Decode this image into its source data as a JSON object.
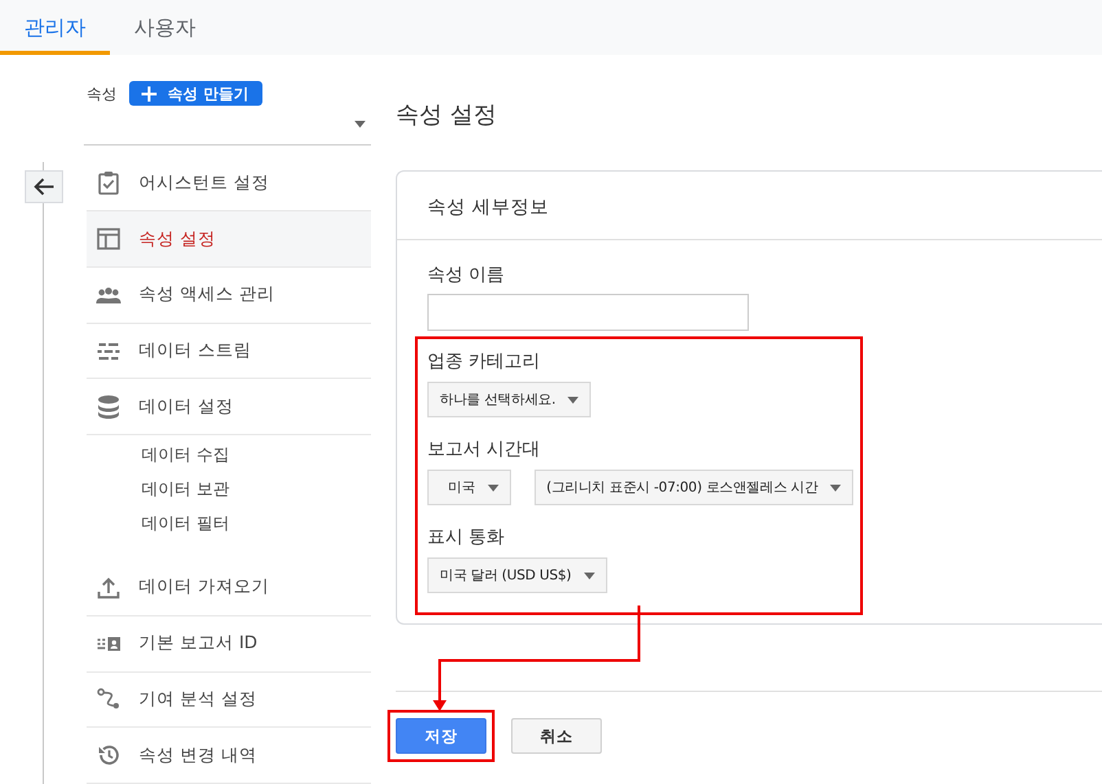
{
  "tabs": [
    {
      "label": "관리자",
      "selected": true
    },
    {
      "label": "사용자",
      "selected": false
    }
  ],
  "property_selector": {
    "label": "속성",
    "create_button": "속성 만들기"
  },
  "nav": {
    "items": [
      {
        "kind": "assistant",
        "label": "어시스턴트 설정",
        "selected": false
      },
      {
        "kind": "property",
        "label": "속성 설정",
        "selected": true
      },
      {
        "kind": "access",
        "label": "속성 액세스 관리",
        "selected": false
      },
      {
        "kind": "stream",
        "label": "데이터 스트림",
        "selected": false
      },
      {
        "kind": "data",
        "label": "데이터 설정",
        "selected": false,
        "children": [
          {
            "label": "데이터 수집",
            "selected": false
          },
          {
            "label": "데이터 보관",
            "selected": false
          },
          {
            "label": "데이터 필터",
            "selected": false
          }
        ]
      },
      {
        "kind": "import",
        "label": "데이터 가져오기",
        "selected": false
      },
      {
        "kind": "report-id",
        "label": "기본 보고서 ID",
        "selected": false
      },
      {
        "kind": "attribution",
        "label": "기여 분석 설정",
        "selected": false
      },
      {
        "kind": "history",
        "label": "속성 변경 내역",
        "selected": false
      }
    ]
  },
  "page_title": "속성 설정",
  "card": {
    "title": "속성 세부정보",
    "fields": [
      {
        "kind": "text",
        "label": "속성 이름",
        "highlighted": false
      },
      {
        "kind": "select",
        "label": "업종 카테고리",
        "highlighted": true,
        "selects": [
          "하나를 선택하세요."
        ]
      },
      {
        "kind": "select",
        "label": "보고서 시간대",
        "highlighted": true,
        "selects": [
          "미국",
          "(그리니치 표준시 -07:00) 로스앤젤레스 시간"
        ]
      },
      {
        "kind": "select",
        "label": "표시 통화",
        "highlighted": true,
        "selects": [
          "미국 달러 (USD US$)"
        ]
      }
    ]
  },
  "buttons": [
    {
      "kind": "primary",
      "label": "저장",
      "highlighted": true
    },
    {
      "kind": "secondary",
      "label": "취소",
      "highlighted": false
    }
  ]
}
